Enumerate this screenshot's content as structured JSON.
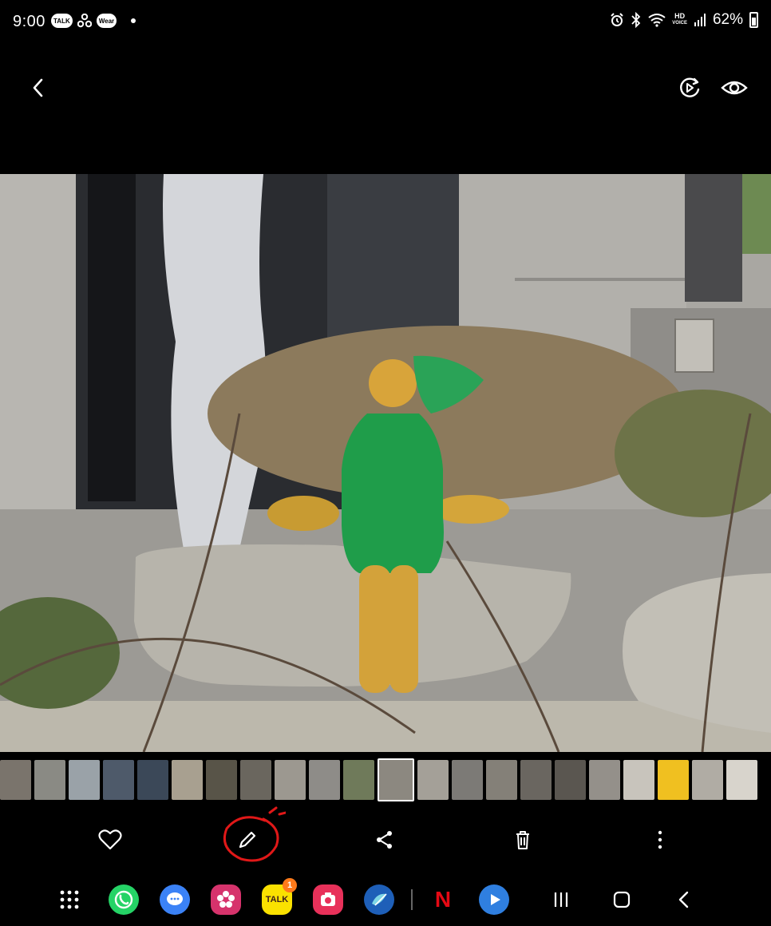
{
  "status_bar": {
    "time": "9:00",
    "left_icons": [
      "talk-icon",
      "fan-icon",
      "wear-icon",
      "dot-icon"
    ],
    "talk_label": "TALK",
    "wear_label": "Wear",
    "right_icons": [
      "alarm-icon",
      "bluetooth-icon",
      "wifi-icon",
      "hd-voice-icon",
      "signal-icon",
      "battery-icon"
    ],
    "hd_label": "HD",
    "voice_label": "VOICE",
    "battery_percent": "62%"
  },
  "top_bar": {
    "icons": [
      "back-icon",
      "remaster-icon",
      "eye-icon"
    ]
  },
  "photo": {
    "description_icon": "photo-sculpture-green-girl"
  },
  "filmstrip": {
    "current_index": 11,
    "thumbnail_colors": [
      "#7a746c",
      "#8a8a84",
      "#9aa2a8",
      "#4e5a6a",
      "#3b4858",
      "#a8a090",
      "#585448",
      "#6a665e",
      "#9c9890",
      "#8e8c88",
      "#6f7a5a",
      "#8c8880",
      "#a4a098",
      "#7c7a76",
      "#848078",
      "#6a6660",
      "#5a5650",
      "#94908a",
      "#c8c4bc",
      "#f0c020",
      "#b0aca4",
      "#d8d4cc"
    ]
  },
  "action_bar": {
    "icons": [
      "heart-icon",
      "edit-icon",
      "share-icon",
      "delete-icon",
      "more-icon"
    ]
  },
  "nav_bar": {
    "apps": [
      "apps-grid-icon",
      "whatsapp-icon",
      "messages-icon",
      "blossom-icon",
      "kakaotalk-icon",
      "camera-icon",
      "bluesky-icon",
      "netflix-icon",
      "play-icon"
    ],
    "kakaotalk_label": "TALK",
    "kakaotalk_badge": "1",
    "netflix_label": "N",
    "system_buttons": [
      "recents-icon",
      "home-icon",
      "nav-back-icon"
    ]
  },
  "colors": {
    "background": "#000000",
    "whatsapp": "#25d366",
    "messages": "#3b82f6",
    "blossom": "#d6336c",
    "kakaotalk": "#fae100",
    "camera": "#e8315a",
    "bluesky": "#1e5fb8",
    "netflix": "#e50914",
    "play": "#2f7fe0",
    "annotation": "#e01818"
  }
}
